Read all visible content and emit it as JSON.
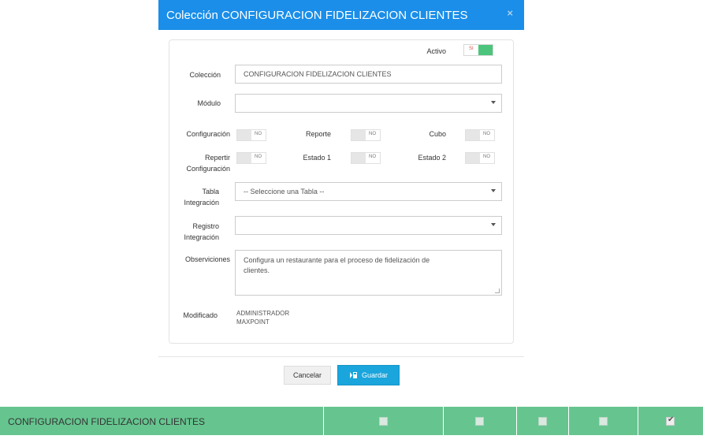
{
  "modal": {
    "title": "Colección CONFIGURACION FIDELIZACION CLIENTES",
    "close_glyph": "×",
    "activo_label": "Activo",
    "activo_toggle_text": "SI",
    "fields": {
      "coleccion_label": "Colección",
      "coleccion_value": "CONFIGURACION FIDELIZACION CLIENTES",
      "modulo_label": "Módulo",
      "modulo_value": "",
      "configuracion_label": "Configuración",
      "reporte_label": "Reporte",
      "cubo_label": "Cubo",
      "repetir_label_1": "Repertir",
      "repetir_label_2": "Configuración",
      "estado1_label": "Estado 1",
      "estado2_label": "Estado 2",
      "toggle_off_text": "NO",
      "tabla_label_1": "Tabla",
      "tabla_label_2": "Integración",
      "tabla_value": "-- Seleccione una Tabla --",
      "registro_label_1": "Registro",
      "registro_label_2": "Integración",
      "registro_value": "",
      "observaciones_label": "Observiciones",
      "observaciones_value_1": "Configura un restaurante para el proceso de fidelización de",
      "observaciones_value_2": "clientes.",
      "modificado_label": "Modificado",
      "modificado_value_1": "ADMINISTRADOR",
      "modificado_value_2": "MAXPOINT"
    },
    "buttons": {
      "cancel_label": "Cancelar",
      "save_label": "Guardar"
    }
  },
  "grid_row": {
    "name": "CONFIGURACION FIDELIZACION CLIENTES",
    "checks": [
      false,
      false,
      false,
      false,
      true
    ]
  },
  "colors": {
    "header": "#1a8ee8",
    "toggle_on": "#4cc47c",
    "save_button": "#1aa5dc",
    "row": "#66c58f"
  }
}
